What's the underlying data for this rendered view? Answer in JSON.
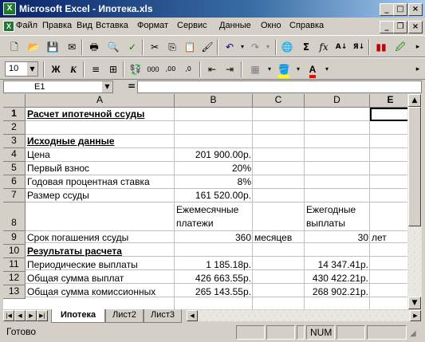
{
  "window": {
    "title": "Microsoft Excel - Ипотека.xls",
    "app_icon": "X"
  },
  "menu": [
    "Файл",
    "Правка",
    "Вид",
    "Вставка",
    "Формат",
    "Сервис",
    "Данные",
    "Окно",
    "Справка"
  ],
  "format_toolbar": {
    "font_size": "10",
    "bold": "Ж",
    "italic": "К",
    "number_format_000": "000"
  },
  "formula_bar": {
    "name_box": "E1",
    "equals": "="
  },
  "grid": {
    "columns": [
      "A",
      "B",
      "C",
      "D",
      "E"
    ],
    "rows": [
      "1",
      "2",
      "3",
      "4",
      "5",
      "6",
      "7",
      "8",
      "9",
      "10",
      "11",
      "12",
      "13"
    ],
    "cells": {
      "A1": "Расчет ипотечной ссуды",
      "A3": "Исходные данные",
      "A4": "Цена",
      "B4": "201 900.00р.",
      "A5": "Первый взнос",
      "B5": "20%",
      "A6": "Годовая процентная ставка",
      "B6": "8%",
      "A7": "Размер ссуды",
      "B7": "161 520.00р.",
      "B8_line1": "Ежемесячные",
      "B8_line2": "платежи",
      "D8_line1": "Ежегодные",
      "D8_line2": "выплаты",
      "A9": "Срок погашения ссуды",
      "B9": "360",
      "C9": "месяцев",
      "D9": "30",
      "E9": "лет",
      "A10": "Результаты расчета",
      "A11": "Периодические выплаты",
      "B11": "1 185.18р.",
      "D11": "14 347.41р.",
      "A12": "Общая сумма выплат",
      "B12": "426 663.55р.",
      "D12": "430 422.21р.",
      "A13": "Общая сумма комиссионных",
      "B13": "265 143.55р.",
      "D13": "268 902.21р."
    }
  },
  "sheets": [
    "Ипотека",
    "Лист2",
    "Лист3"
  ],
  "status": {
    "ready": "Готово",
    "num": "NUM"
  }
}
